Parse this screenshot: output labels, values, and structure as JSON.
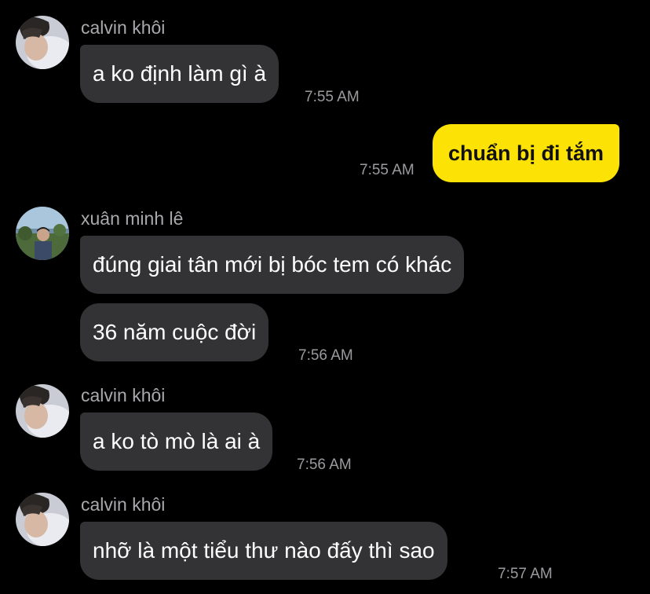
{
  "colors": {
    "background": "#000000",
    "incoming_bubble": "#333336",
    "outgoing_bubble": "#fce205",
    "sender_name": "#a9a9ad",
    "timestamp": "#9b9b9f"
  },
  "messages": [
    {
      "sender": "calvin khôi",
      "direction": "incoming",
      "avatar": "calvin-avatar",
      "texts": [
        "a ko định làm gì à"
      ],
      "time": "7:55 AM"
    },
    {
      "sender": "",
      "direction": "outgoing",
      "texts": [
        "chuẩn bị đi tắm"
      ],
      "time": "7:55 AM"
    },
    {
      "sender": "xuân minh lê",
      "direction": "incoming",
      "avatar": "xuan-minh-avatar",
      "texts": [
        "đúng giai tân mới bị bóc tem có khác",
        "36 năm cuộc đời"
      ],
      "time": "7:56 AM"
    },
    {
      "sender": "calvin khôi",
      "direction": "incoming",
      "avatar": "calvin-avatar",
      "texts": [
        "a ko tò mò là ai à"
      ],
      "time": "7:56 AM"
    },
    {
      "sender": "calvin khôi",
      "direction": "incoming",
      "avatar": "calvin-avatar",
      "texts": [
        "nhỡ là một tiểu thư nào đấy thì sao"
      ],
      "time": "7:57 AM"
    }
  ]
}
